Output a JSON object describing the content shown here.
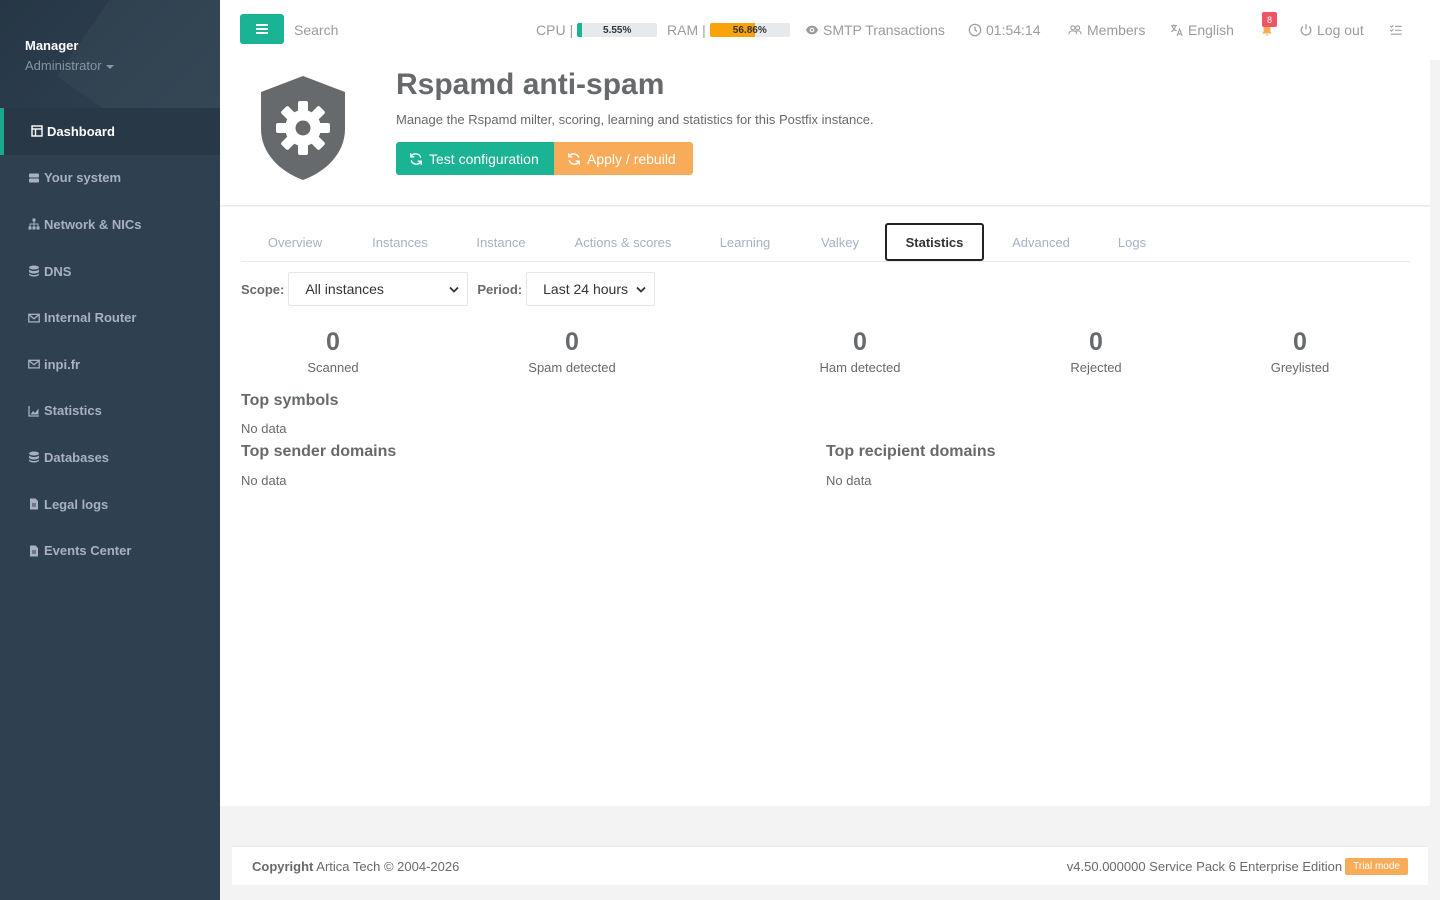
{
  "sidebar": {
    "user_name": "Manager",
    "user_role": "Administrator",
    "items": [
      {
        "label": "Dashboard",
        "icon": "dashboard-icon"
      },
      {
        "label": "Your system",
        "icon": "server-icon"
      },
      {
        "label": "Network & NICs",
        "icon": "network-icon"
      },
      {
        "label": "DNS",
        "icon": "database-icon"
      },
      {
        "label": "Internal Router",
        "icon": "envelope-icon"
      },
      {
        "label": "inpi.fr",
        "icon": "envelope-icon"
      },
      {
        "label": "Statistics",
        "icon": "chart-icon"
      },
      {
        "label": "Databases",
        "icon": "database-icon"
      },
      {
        "label": "Legal logs",
        "icon": "file-icon"
      },
      {
        "label": "Events Center",
        "icon": "file-icon"
      }
    ]
  },
  "topbar": {
    "search_placeholder": "Search",
    "cpu_label": "CPU",
    "cpu_value": "5.55%",
    "cpu_fraction": 0.0555,
    "cpu_color": "#1ab394",
    "ram_label": "RAM",
    "ram_value": "56.86%",
    "ram_fraction": 0.5686,
    "ram_color": "#f8a30a",
    "separator": "|",
    "smtp_label": "SMTP Transactions",
    "clock": "01:54:14",
    "members_label": "Members",
    "language": "English",
    "notifications_count": "8",
    "logout_label": "Log out"
  },
  "header": {
    "title": "Rspamd anti-spam",
    "description": "Manage the Rspamd milter, scoring, learning and statistics for this Postfix instance.",
    "test_button": "Test configuration",
    "apply_button": "Apply / rebuild"
  },
  "tabs": [
    {
      "label": "Overview",
      "active": false
    },
    {
      "label": "Instances",
      "active": false
    },
    {
      "label": "Instance",
      "active": false
    },
    {
      "label": "Actions & scores",
      "active": false
    },
    {
      "label": "Learning",
      "active": false
    },
    {
      "label": "Valkey",
      "active": false
    },
    {
      "label": "Statistics",
      "active": true
    },
    {
      "label": "Advanced",
      "active": false
    },
    {
      "label": "Logs",
      "active": false
    }
  ],
  "filters": {
    "scope_label": "Scope:",
    "scope_value": "All instances",
    "period_label": "Period:",
    "period_value": "Last 24 hours"
  },
  "stats": [
    {
      "value": "0",
      "label": "Scanned"
    },
    {
      "value": "0",
      "label": "Spam detected"
    },
    {
      "value": "0",
      "label": "Ham detected"
    },
    {
      "value": "0",
      "label": "Rejected"
    },
    {
      "value": "0",
      "label": "Greylisted"
    }
  ],
  "sections": {
    "top_symbols": {
      "title": "Top symbols",
      "empty": "No data"
    },
    "top_sender_domains": {
      "title": "Top sender domains",
      "empty": "No data"
    },
    "top_recipient_domains": {
      "title": "Top recipient domains",
      "empty": "No data"
    }
  },
  "footer": {
    "copyright_bold": "Copyright",
    "copyright_text": " Artica Tech © 2004-2026",
    "version": "v4.50.000000 Service Pack 6 Enterprise Edition",
    "trial": "Trial mode"
  }
}
